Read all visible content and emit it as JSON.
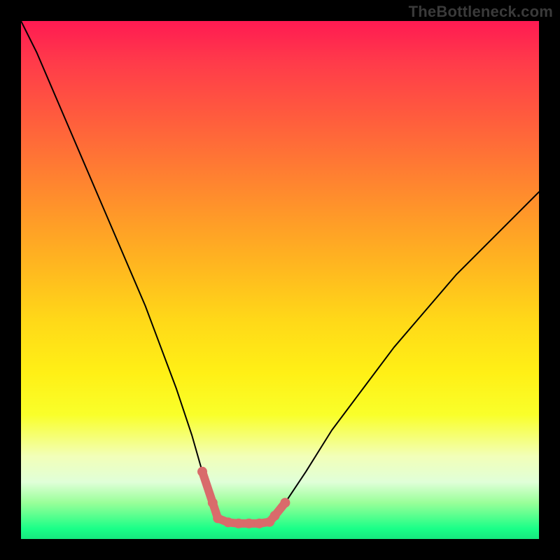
{
  "watermark": {
    "text": "TheBottleneck.com"
  },
  "chart_data": {
    "type": "line",
    "title": "",
    "xlabel": "",
    "ylabel": "",
    "xlim": [
      0,
      100
    ],
    "ylim": [
      0,
      100
    ],
    "background_gradient_note": "vertical heatmap: red (high bottleneck) at top → green (balanced) at bottom",
    "series": [
      {
        "name": "bottleneck-curve",
        "note": "V-shaped curve; descends sharply from top-left to a flat minimum near x≈38-48, then rises to upper-right. Values are fraction of plot height from bottom (0=bottom,100=top).",
        "x": [
          0,
          3,
          6,
          9,
          12,
          15,
          18,
          21,
          24,
          27,
          30,
          33,
          35,
          37,
          38,
          40,
          42,
          44,
          46,
          48,
          49,
          51,
          55,
          60,
          66,
          72,
          78,
          84,
          90,
          96,
          100
        ],
        "y": [
          100,
          94,
          87,
          80,
          73,
          66,
          59,
          52,
          45,
          37,
          29,
          20,
          13,
          7,
          4,
          3.2,
          3,
          3,
          3,
          3.3,
          4.5,
          7,
          13,
          21,
          29,
          37,
          44,
          51,
          57,
          63,
          67
        ]
      },
      {
        "name": "optimal-range-marker",
        "note": "thick pink/coral segment with round end-dots marking the flat bottom of the V (optimal / no-bottleneck zone)",
        "x": [
          35,
          37,
          38,
          40,
          42,
          44,
          46,
          48,
          49,
          51
        ],
        "y": [
          13,
          7,
          4,
          3.2,
          3,
          3,
          3,
          3.3,
          4.5,
          7
        ],
        "color": "#d96b6b",
        "stroke_width_px": 12,
        "dot_radius_px": 7
      }
    ]
  }
}
